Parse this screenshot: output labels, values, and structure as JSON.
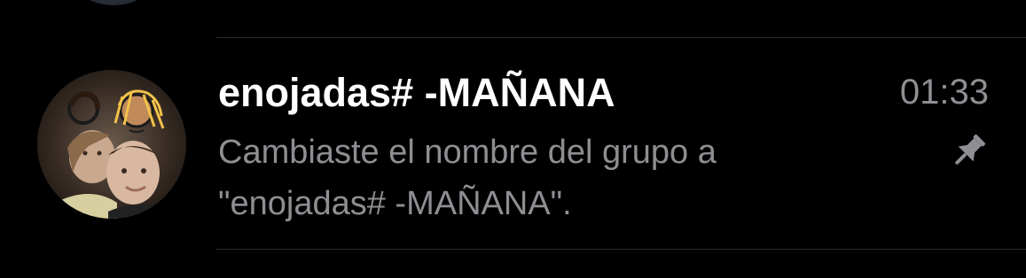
{
  "chat": {
    "title": "enojadas# -MAÑANA",
    "time": "01:33",
    "preview_line1": "Cambiaste el nombre del grupo a",
    "preview_line2": "\"enojadas# -MAÑANA\".",
    "pinned": true,
    "avatar_icon": "group-photo",
    "pin_icon": "pin-icon"
  },
  "colors": {
    "background": "#000000",
    "title": "#ffffff",
    "secondary": "#8e8e93",
    "divider": "#2a2a2c"
  }
}
